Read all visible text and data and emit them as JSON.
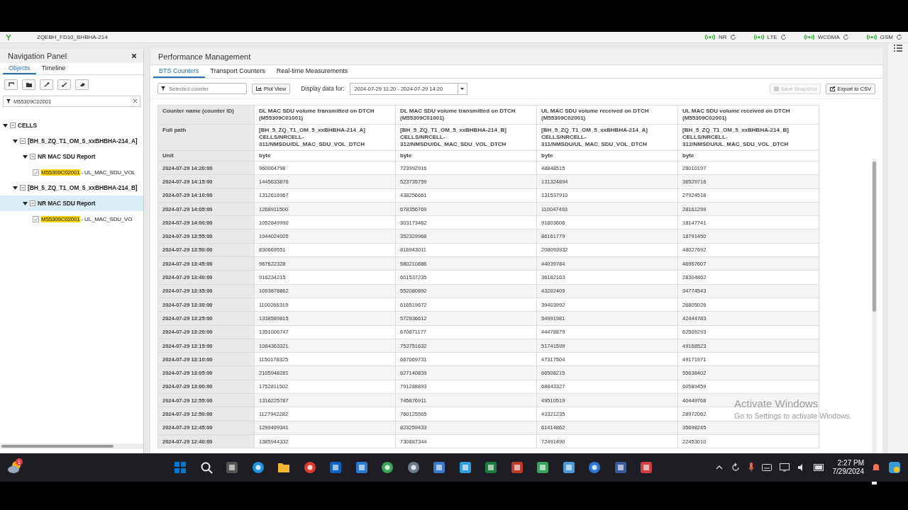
{
  "top_strip": {
    "site": "ZQEBH_FD10_BHBHA-214",
    "technologies": [
      {
        "label": "NR"
      },
      {
        "label": "LTE"
      },
      {
        "label": "WCDMA"
      },
      {
        "label": "GSM"
      }
    ]
  },
  "navigation_panel": {
    "title": "Navigation Panel",
    "tabs": [
      {
        "label": "Objects",
        "selected": true
      },
      {
        "label": "Timeline",
        "selected": false
      }
    ],
    "filter": {
      "value": "M55309C02001"
    },
    "tree": [
      {
        "kind": "group",
        "label": "CELLS",
        "expanded": true,
        "selected": false,
        "children": [
          {
            "kind": "group",
            "label": "[BH_5_ZQ_T1_OM_5_xxBHBHA-214_A]",
            "expanded": true,
            "selected": false,
            "children": [
              {
                "kind": "group",
                "label": "NR MAC SDU Report",
                "expanded": true,
                "selected": false,
                "children": [
                  {
                    "kind": "counter",
                    "match": "M55309C02001",
                    "label": " - UL_MAC_SDU_VOL",
                    "checked": true,
                    "selected": false
                  }
                ]
              }
            ]
          },
          {
            "kind": "group",
            "label": "[BH_5_ZQ_T1_OM_5_xxBHBHA-214_B]",
            "expanded": true,
            "selected": false,
            "children": [
              {
                "kind": "group",
                "label": "NR MAC SDU Report",
                "expanded": true,
                "selected": true,
                "children": [
                  {
                    "kind": "counter",
                    "match": "M55309C02001",
                    "label": " - UL_MAC_SDU_VO",
                    "checked": true,
                    "selected": false
                  }
                ]
              }
            ]
          }
        ]
      }
    ]
  },
  "performance_management": {
    "title": "Performance Management",
    "tabs": [
      {
        "label": "BTS Counters",
        "selected": true
      },
      {
        "label": "Transport Counters",
        "selected": false
      },
      {
        "label": "Real-time Measurements",
        "selected": false
      }
    ],
    "counter_filter": {
      "placeholder": "Selected counter"
    },
    "plot_button": "Plot View",
    "display_label": "Display data for:",
    "period": {
      "value": "2024-07-29 11:20 - 2024-07-29 14:20"
    },
    "buttons": [
      {
        "label": "Save Snapshot",
        "disabled": true
      },
      {
        "label": "Export to CSV",
        "disabled": false
      }
    ],
    "table": {
      "header_labels": [
        "Counter name (counter ID)",
        "Full path",
        "Unit"
      ],
      "columns": [
        {
          "name": "DL MAC SDU volume transmitted on DTCH (M55309C01001)",
          "path": "[BH_5_ZQ_T1_OM_5_xxBHBHA-214_A] CELLS/NRCELL-311/NMSDU/DL_MAC_SDU_VOL_DTCH",
          "unit": "byte"
        },
        {
          "name": "DL MAC SDU volume transmitted on DTCH (M55309C01001)",
          "path": "[BH_5_ZQ_T1_OM_5_xxBHBHA-214_B] CELLS/NRCELL-312/NMSDU/DL_MAC_SDU_VOL_DTCH",
          "unit": "byte"
        },
        {
          "name": "UL MAC SDU volume received on DTCH (M55309C02001)",
          "path": "[BH_5_ZQ_T1_OM_5_xxBHBHA-214_A] CELLS/NRCELL-311/NMSDU/UL_MAC_SDU_VOL_DTCH",
          "unit": "byte"
        },
        {
          "name": "UL MAC SDU volume received on DTCH (M55309C02001)",
          "path": "[BH_5_ZQ_T1_OM_5_xxBHBHA-214_B] CELLS/NRCELL-312/NMSDU/UL_MAC_SDU_VOL_DTCH",
          "unit": "byte"
        }
      ],
      "rows": [
        {
          "time": "2024-07-29 14:20:00",
          "values": [
            "960064798",
            "723992916",
            "48848515",
            "28010197"
          ]
        },
        {
          "time": "2024-07-29 14:15:00",
          "values": [
            "1445633876",
            "523735759",
            "131324894",
            "36529716"
          ]
        },
        {
          "time": "2024-07-29 14:10:00",
          "values": [
            "1312616967",
            "438256661",
            "131537910",
            "27924518"
          ]
        },
        {
          "time": "2024-07-29 14:05:00",
          "values": [
            "1268911500",
            "678356769",
            "110047493",
            "28161299"
          ]
        },
        {
          "time": "2024-07-29 14:00:00",
          "values": [
            "1052849990",
            "303173462",
            "91803606",
            "18147741"
          ]
        },
        {
          "time": "2024-07-29 13:55:00",
          "values": [
            "1044024005",
            "352329968",
            "86161779",
            "18791450"
          ]
        },
        {
          "time": "2024-07-29 13:50:00",
          "values": [
            "830669551",
            "816943011",
            "208093932",
            "48027692"
          ]
        },
        {
          "time": "2024-07-29 13:45:00",
          "values": [
            "967622328",
            "580210886",
            "44039784",
            "46957607"
          ]
        },
        {
          "time": "2024-07-29 13:40:00",
          "values": [
            "916234215",
            "601537235",
            "36182163",
            "28304862"
          ]
        },
        {
          "time": "2024-07-29 13:35:00",
          "values": [
            "1093878862",
            "552080892",
            "43202409",
            "34774543"
          ]
        },
        {
          "time": "2024-07-29 13:30:00",
          "values": [
            "1100266319",
            "616519672",
            "39403992",
            "26805026"
          ]
        },
        {
          "time": "2024-07-29 13:25:00",
          "values": [
            "1338589815",
            "572936612",
            "54991981",
            "42444783"
          ]
        },
        {
          "time": "2024-07-29 13:20:00",
          "values": [
            "1351006747",
            "670871177",
            "44478879",
            "62509293"
          ]
        },
        {
          "time": "2024-07-29 13:15:00",
          "values": [
            "1084363321",
            "753751632",
            "51741599",
            "49168523"
          ]
        },
        {
          "time": "2024-07-29 13:10:00",
          "values": [
            "1150178325",
            "667069731",
            "47317504",
            "49171971"
          ]
        },
        {
          "time": "2024-07-29 13:05:00",
          "values": [
            "2105948281",
            "627140839",
            "66508215",
            "55638402"
          ]
        },
        {
          "time": "2024-07-29 13:00:00",
          "values": [
            "1752811502",
            "791288893",
            "68843327",
            "60589459"
          ]
        },
        {
          "time": "2024-07-29 12:55:00",
          "values": [
            "1316225787",
            "745876911",
            "49510519",
            "40449768"
          ]
        },
        {
          "time": "2024-07-29 12:50:00",
          "values": [
            "1127942282",
            "760125565",
            "43321235",
            "28972062"
          ]
        },
        {
          "time": "2024-07-29 12:45:00",
          "values": [
            "1299499341",
            "823259433",
            "61414862",
            "35698245"
          ]
        },
        {
          "time": "2024-07-29 12:40:00",
          "values": [
            "1385944332",
            "730887344",
            "72491490",
            "22453010"
          ]
        }
      ]
    },
    "activation_notice": {
      "title": "Activate Windows",
      "text": "Go to Settings to activate Windows."
    }
  },
  "taskbar": {
    "time": "2:27 PM",
    "date": "7/29/2024",
    "badge": "1"
  }
}
